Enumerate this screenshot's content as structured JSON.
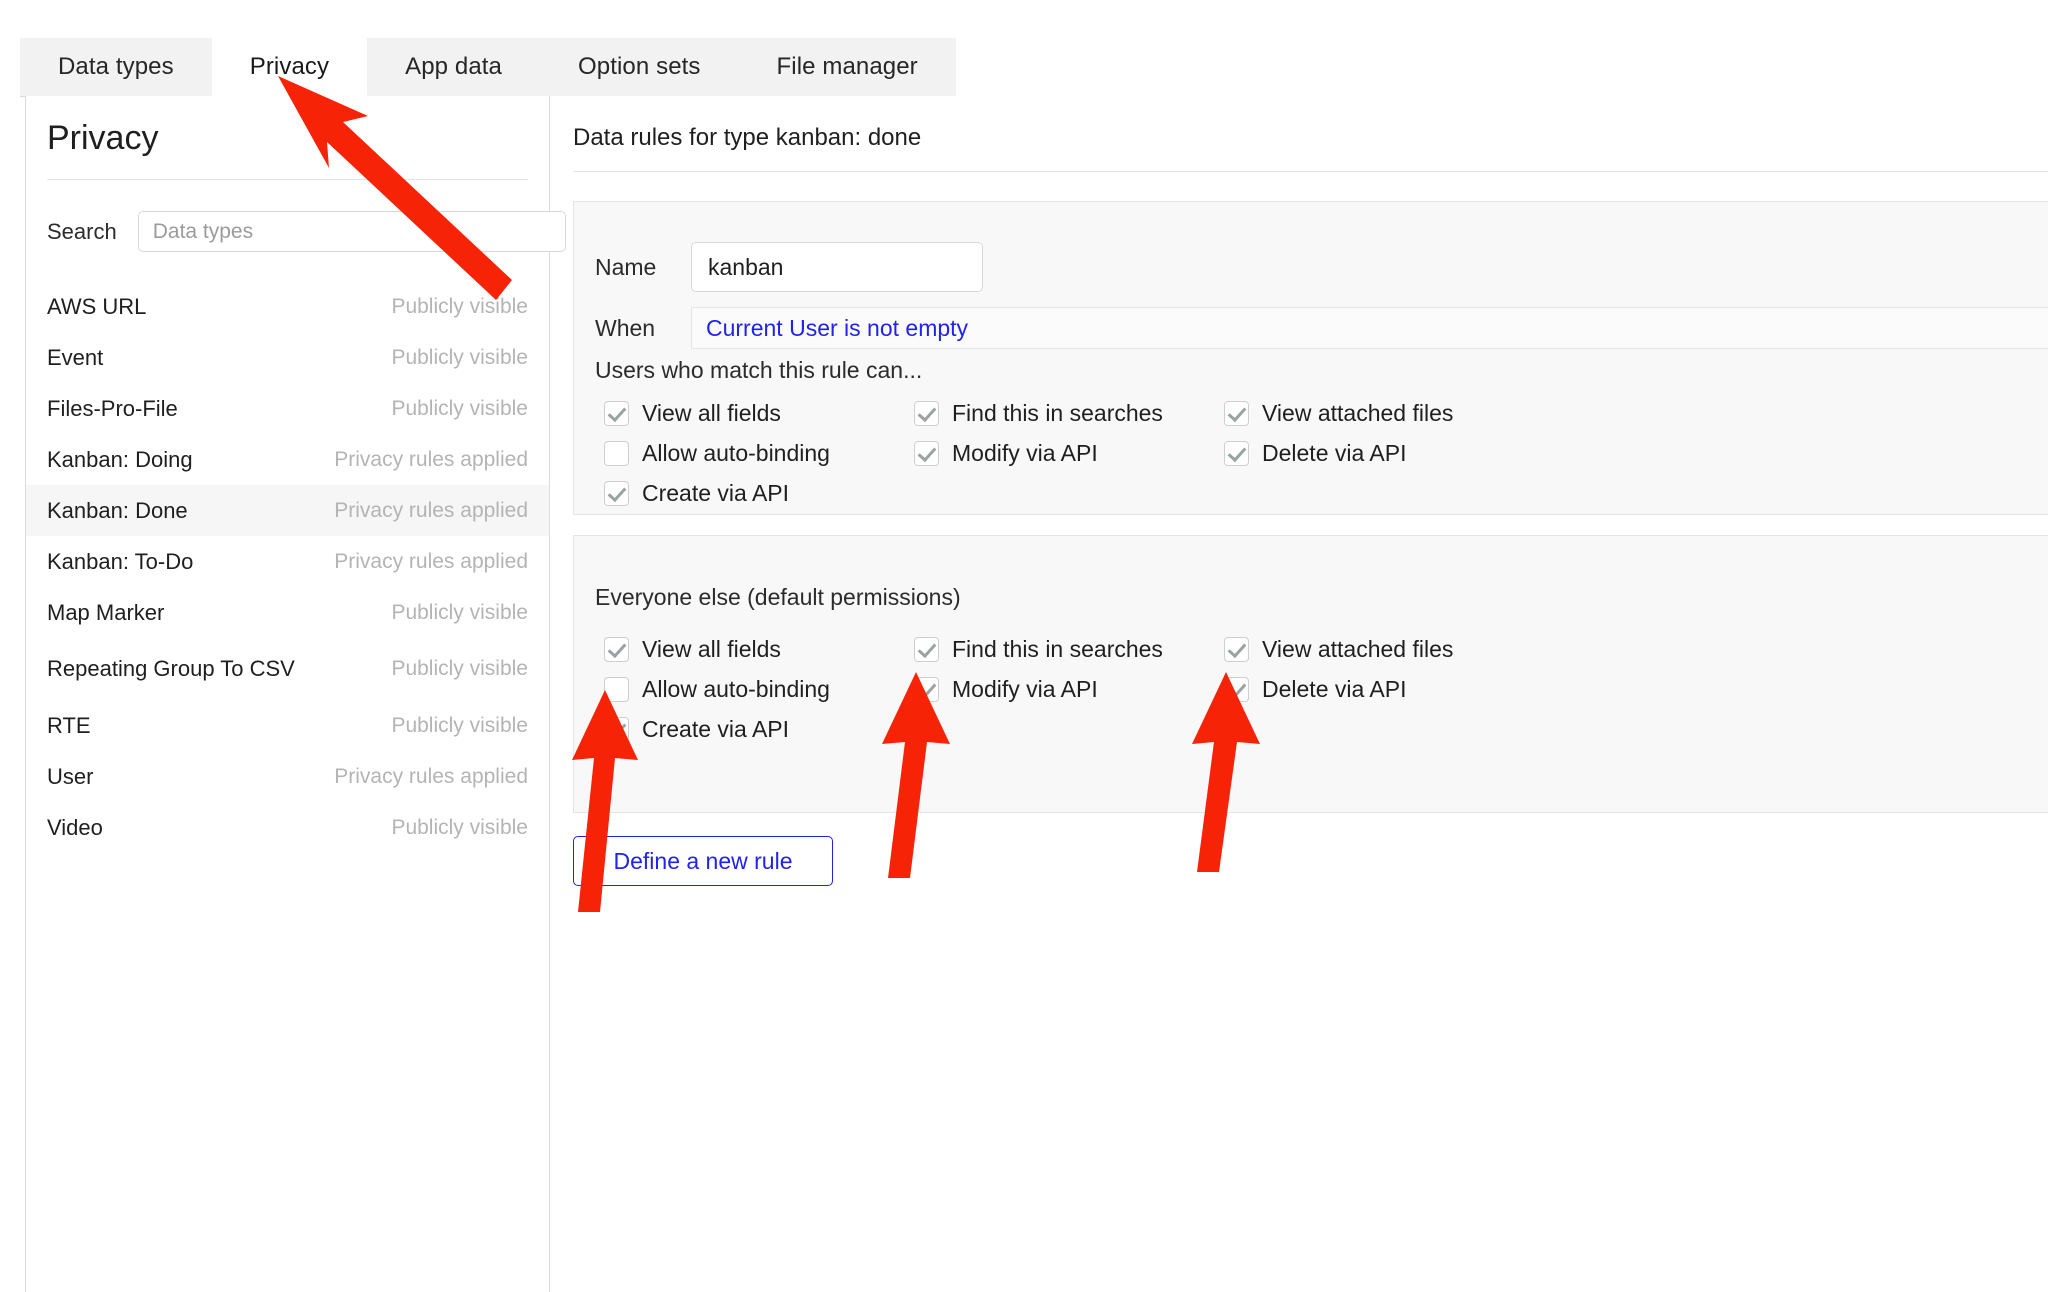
{
  "tabs": [
    {
      "label": "Data types",
      "active": false
    },
    {
      "label": "Privacy",
      "active": true
    },
    {
      "label": "App data",
      "active": false
    },
    {
      "label": "Option sets",
      "active": false
    },
    {
      "label": "File manager",
      "active": false
    }
  ],
  "left_pane": {
    "title": "Privacy",
    "search": {
      "label": "Search",
      "value": "",
      "placeholder": "Data types"
    },
    "data_types": [
      {
        "name": "AWS URL",
        "status": "Publicly visible",
        "selected": false,
        "two_line": false
      },
      {
        "name": "Event",
        "status": "Publicly visible",
        "selected": false,
        "two_line": false
      },
      {
        "name": "Files-Pro-File",
        "status": "Publicly visible",
        "selected": false,
        "two_line": false
      },
      {
        "name": "Kanban: Doing",
        "status": "Privacy rules applied",
        "selected": false,
        "two_line": false
      },
      {
        "name": "Kanban: Done",
        "status": "Privacy rules applied",
        "selected": true,
        "two_line": false
      },
      {
        "name": "Kanban: To-Do",
        "status": "Privacy rules applied",
        "selected": false,
        "two_line": false
      },
      {
        "name": "Map Marker",
        "status": "Publicly visible",
        "selected": false,
        "two_line": false
      },
      {
        "name": "Repeating Group To CSV",
        "status": "Publicly visible",
        "selected": false,
        "two_line": true
      },
      {
        "name": "RTE",
        "status": "Publicly visible",
        "selected": false,
        "two_line": false
      },
      {
        "name": "User",
        "status": "Privacy rules applied",
        "selected": false,
        "two_line": false
      },
      {
        "name": "Video",
        "status": "Publicly visible",
        "selected": false,
        "two_line": false
      }
    ]
  },
  "right_pane": {
    "title": "Data rules for type kanban: done",
    "rule": {
      "name_label": "Name",
      "name_value": "kanban",
      "when_label": "When",
      "when_expression": "Current User is not empty",
      "match_caption": "Users who match this rule can...",
      "permissions": [
        {
          "label": "View all fields",
          "checked": true
        },
        {
          "label": "Find this in searches",
          "checked": true
        },
        {
          "label": "View attached files",
          "checked": true
        },
        {
          "label": "Allow auto-binding",
          "checked": false
        },
        {
          "label": "Modify via API",
          "checked": true
        },
        {
          "label": "Delete via API",
          "checked": true
        },
        {
          "label": "Create via API",
          "checked": true
        }
      ]
    },
    "default_rule": {
      "caption": "Everyone else (default permissions)",
      "permissions": [
        {
          "label": "View all fields",
          "checked": true
        },
        {
          "label": "Find this in searches",
          "checked": true
        },
        {
          "label": "View attached files",
          "checked": true
        },
        {
          "label": "Allow auto-binding",
          "checked": false
        },
        {
          "label": "Modify via API",
          "checked": true
        },
        {
          "label": "Delete via API",
          "checked": true
        },
        {
          "label": "Create via API",
          "checked": true
        }
      ]
    },
    "define_new_rule_label": "Define a new rule"
  },
  "annotations": {
    "arrow_color": "#f62306",
    "arrows": [
      {
        "name": "arrow-to-privacy-tab"
      },
      {
        "name": "arrow-to-create-via-api"
      },
      {
        "name": "arrow-to-modify-via-api"
      },
      {
        "name": "arrow-to-delete-via-api"
      }
    ]
  }
}
